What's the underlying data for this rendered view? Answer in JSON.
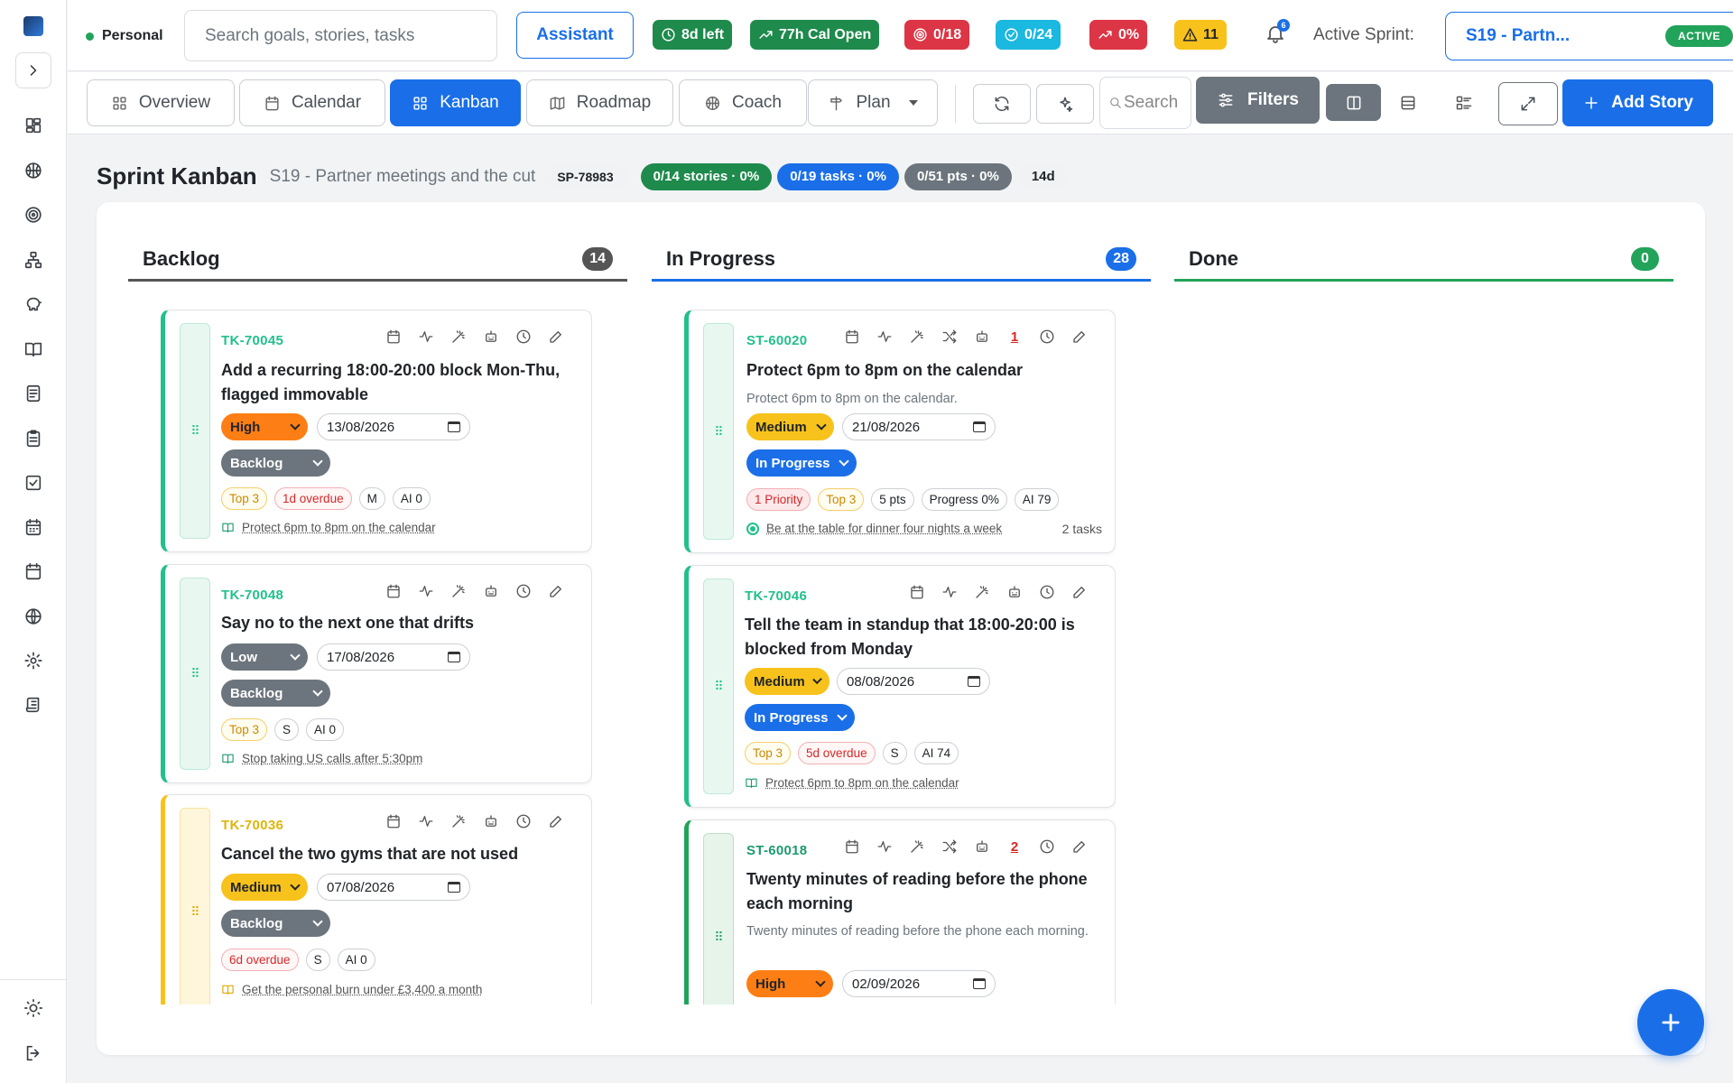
{
  "topbar": {
    "persona": "Personal",
    "search_placeholder": "Search goals, stories, tasks",
    "assistant": "Assistant",
    "pills": [
      {
        "label": "8d left",
        "color": "#1e8a4c",
        "icon": "clock-icon"
      },
      {
        "label": "77h Cal Open",
        "color": "#1e8a4c",
        "icon": "trend-up-icon"
      },
      {
        "label": "0/18",
        "color": "#dc3545",
        "icon": "target-icon"
      },
      {
        "label": "0/24",
        "color": "#1bb8e0",
        "icon": "check-circle-icon"
      },
      {
        "label": "0%",
        "color": "#dc3545",
        "icon": "trend-up-icon"
      },
      {
        "label": "11",
        "color": "#f7c21b",
        "icon": "warning-icon"
      }
    ],
    "notifications": "6",
    "active_sprint_label": "Active Sprint:",
    "sprint_name": "S19 - Partn...",
    "sprint_status": "ACTIVE"
  },
  "tabs": {
    "overview": "Overview",
    "calendar": "Calendar",
    "kanban": "Kanban",
    "roadmap": "Roadmap",
    "coach": "Coach",
    "plan": "Plan",
    "search_placeholder": "Search",
    "filters": "Filters",
    "add_story": "Add Story"
  },
  "header": {
    "title": "Sprint Kanban",
    "subtitle": "S19 - Partner meetings and the cut",
    "sprint_id": "SP-78983",
    "stories": "0/14 stories · 0%",
    "tasks": "0/19 tasks · 0%",
    "points": "0/51 pts · 0%",
    "duration": "14d"
  },
  "colors": {
    "primary": "#1a6fe8",
    "success": "#22a35a",
    "teal": "#22c08a",
    "danger": "#dc3545",
    "warning": "#f7c21b",
    "secondary": "#6c757d"
  },
  "columns": [
    {
      "name": "Backlog",
      "count": "14",
      "color": "#555555"
    },
    {
      "name": "In Progress",
      "count": "28",
      "color": "#1a6fe8"
    },
    {
      "name": "Done",
      "count": "0",
      "color": "#22a35a"
    }
  ],
  "backlog_cards": [
    {
      "id": "TK-70045",
      "title": "Add a recurring 18:00-20:00 block Mon-Thu, flagged immovable",
      "priority": "High",
      "date": "13/08/2026",
      "status": "Backlog",
      "chips": [
        "Top 3",
        "1d overdue",
        "M",
        "AI 0"
      ],
      "link": "Protect 6pm to 8pm on the calendar"
    },
    {
      "id": "TK-70048",
      "title": "Say no to the next one that drifts",
      "priority": "Low",
      "date": "17/08/2026",
      "status": "Backlog",
      "chips": [
        "Top 3",
        "S",
        "AI 0"
      ],
      "link": "Stop taking US calls after 5:30pm"
    },
    {
      "id": "TK-70036",
      "title": "Cancel the two gyms that are not used",
      "priority": "Medium",
      "date": "07/08/2026",
      "status": "Backlog",
      "chips": [
        "6d overdue",
        "S",
        "AI 0"
      ],
      "link": "Get the personal burn under £3,400 a month"
    }
  ],
  "progress_cards": [
    {
      "id": "ST-60020",
      "count": "1",
      "title": "Protect 6pm to 8pm on the calendar",
      "desc": "Protect 6pm to 8pm on the calendar.",
      "priority": "Medium",
      "date": "21/08/2026",
      "status": "In Progress",
      "chips": [
        "1 Priority",
        "Top 3",
        "5 pts",
        "Progress 0%",
        "AI 79"
      ],
      "link": "Be at the table for dinner four nights a week",
      "tasks": "2 tasks"
    },
    {
      "id": "TK-70046",
      "title": "Tell the team in standup that 18:00-20:00 is blocked from Monday",
      "priority": "Medium",
      "date": "08/08/2026",
      "status": "In Progress",
      "chips": [
        "Top 3",
        "5d overdue",
        "S",
        "AI 74"
      ],
      "link": "Protect 6pm to 8pm on the calendar"
    },
    {
      "id": "ST-60018",
      "count": "2",
      "title": "Twenty minutes of reading before the phone each morning",
      "desc": "Twenty minutes of reading before the phone each morning.",
      "priority": "High",
      "date": "02/09/2026"
    }
  ]
}
